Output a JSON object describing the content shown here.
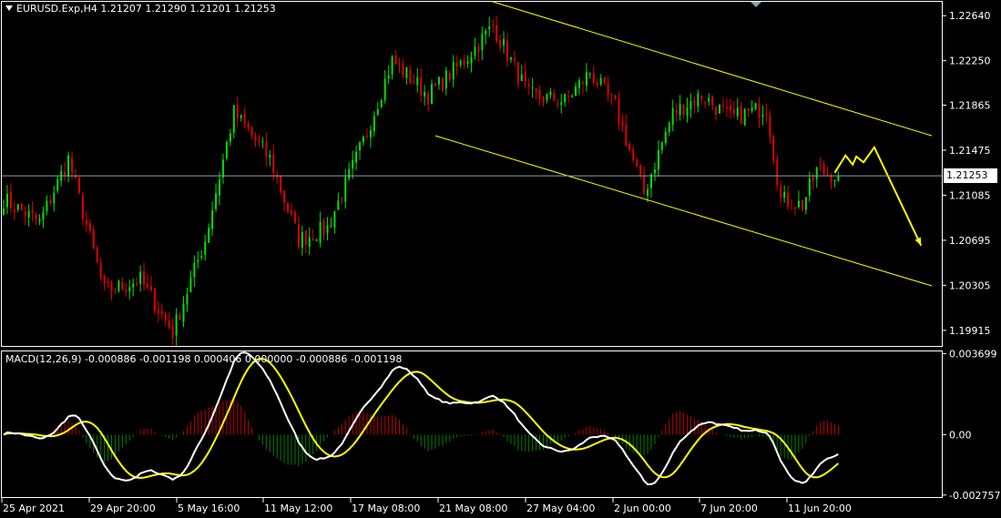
{
  "header": {
    "symbol_line": "EURUSD.Exp,H4  1.21207 1.21290 1.21201 1.21253"
  },
  "macd_header": "MACD(12,26,9) -0.000886 -0.001198 0.000406 0.000000 -0.000886 -0.001198",
  "current_price_label": "1.21253",
  "colors": {
    "background": "#000000",
    "bull_candle": "#00e000",
    "bear_candle": "#e00000",
    "channel": "#ffff00",
    "forecast_arrow": "#ffff00",
    "grid_frame": "#ffffff",
    "macd_line": "#ffffff",
    "signal_line": "#ffff00",
    "hist_pos": "#c00000",
    "hist_neg": "#008000"
  },
  "chart_data": [
    {
      "type": "candlestick",
      "title": "EURUSD.Exp,H4",
      "y_axis_ticks": [
        "1.22640",
        "1.22250",
        "1.21865",
        "1.21475",
        "1.21085",
        "1.20695",
        "1.20305",
        "1.19915"
      ],
      "ylim": [
        1.1978,
        1.2276
      ],
      "x_axis_ticks": [
        "25 Apr 2021",
        "29 Apr 20:00",
        "5 May 16:00",
        "11 May 12:00",
        "17 May 08:00",
        "21 May 08:00",
        "27 May 04:00",
        "2 Jun 00:00",
        "7 Jun 20:00",
        "11 Jun 20:00"
      ],
      "last_ohlc": {
        "open": 1.21207,
        "high": 1.2129,
        "low": 1.21201,
        "close": 1.21253
      },
      "current_price": 1.21253,
      "close_path_keypoints": [
        {
          "bar": 0,
          "close": 1.2105
        },
        {
          "bar": 10,
          "close": 1.2085
        },
        {
          "bar": 18,
          "close": 1.214
        },
        {
          "bar": 28,
          "close": 1.2025
        },
        {
          "bar": 38,
          "close": 1.2035
        },
        {
          "bar": 47,
          "close": 1.199
        },
        {
          "bar": 56,
          "close": 1.207
        },
        {
          "bar": 64,
          "close": 1.218
        },
        {
          "bar": 74,
          "close": 1.214
        },
        {
          "bar": 82,
          "close": 1.207
        },
        {
          "bar": 90,
          "close": 1.208
        },
        {
          "bar": 100,
          "close": 1.2155
        },
        {
          "bar": 108,
          "close": 1.2225
        },
        {
          "bar": 118,
          "close": 1.2195
        },
        {
          "bar": 128,
          "close": 1.2225
        },
        {
          "bar": 136,
          "close": 1.2255
        },
        {
          "bar": 146,
          "close": 1.2195
        },
        {
          "bar": 156,
          "close": 1.219
        },
        {
          "bar": 163,
          "close": 1.2215
        },
        {
          "bar": 170,
          "close": 1.2185
        },
        {
          "bar": 178,
          "close": 1.211
        },
        {
          "bar": 186,
          "close": 1.218
        },
        {
          "bar": 194,
          "close": 1.2195
        },
        {
          "bar": 202,
          "close": 1.2175
        },
        {
          "bar": 212,
          "close": 1.2185
        },
        {
          "bar": 216,
          "close": 1.2105
        },
        {
          "bar": 222,
          "close": 1.21
        },
        {
          "bar": 226,
          "close": 1.213
        },
        {
          "bar": 232,
          "close": 1.2125
        }
      ],
      "channel": {
        "upper": [
          {
            "bar": 136,
            "price": 1.2276
          },
          {
            "bar": 258,
            "price": 1.216
          }
        ],
        "lower": [
          {
            "bar": 120,
            "price": 1.216
          },
          {
            "bar": 258,
            "price": 1.203
          }
        ]
      },
      "forecast_path": [
        {
          "bar": 231,
          "price": 1.2128
        },
        {
          "bar": 234,
          "price": 1.2143
        },
        {
          "bar": 236,
          "price": 1.2135
        },
        {
          "bar": 237,
          "price": 1.2142
        },
        {
          "bar": 239,
          "price": 1.2137
        },
        {
          "bar": 242,
          "price": 1.215
        },
        {
          "bar": 255,
          "price": 1.2065
        }
      ]
    },
    {
      "type": "macd",
      "title": "MACD(12,26,9)",
      "params": [
        12,
        26,
        9
      ],
      "y_axis_ticks": [
        "0.003699",
        "0.00",
        "-0.002757"
      ],
      "ylim": [
        -0.00285,
        0.0038
      ]
    }
  ]
}
